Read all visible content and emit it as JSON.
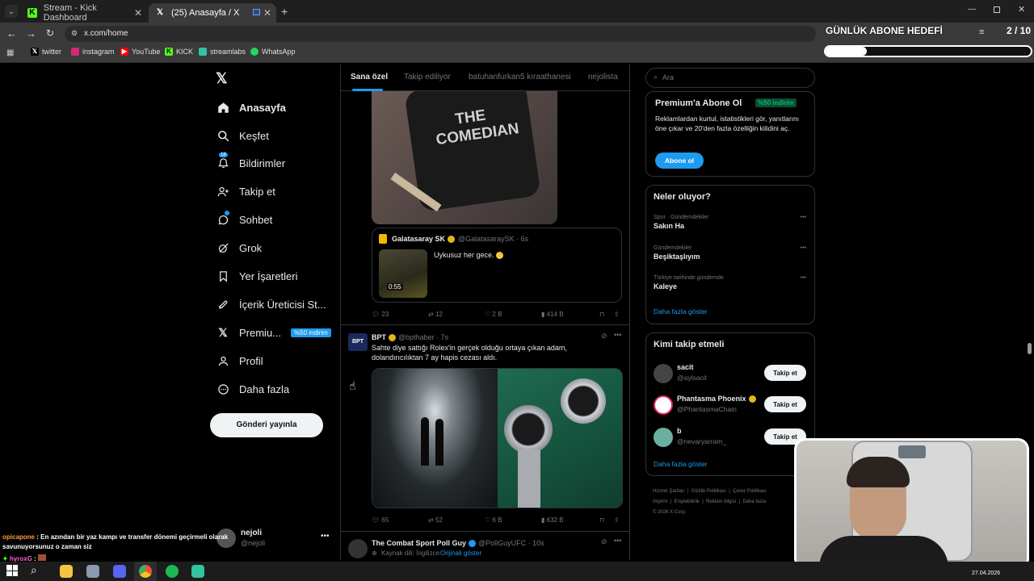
{
  "browser": {
    "tabs": [
      {
        "label": "Stream - Kick Dashboard",
        "icon": "kick-icon"
      },
      {
        "label": "(25) Anasayfa / X",
        "icon": "x-logo-icon"
      }
    ],
    "url": "x.com/home",
    "bookmarks": [
      "twitter",
      "instagram",
      "YouTube",
      "KICK",
      "streamlabs",
      "WhatsApp"
    ]
  },
  "overlay": {
    "goal_title": "GÜNLÜK ABONE HEDEFİ",
    "goal_count": "2 / 10",
    "goal_progress": 0.2,
    "chat": [
      {
        "user": "opicapone",
        "text": "En azından bir yaz kampı ve transfer dönemi geçirmeli olarak savunuyorsunuz o zaman siz"
      },
      {
        "user": "hyroxG",
        "text": ""
      }
    ]
  },
  "nav": {
    "items": [
      {
        "label": "Anasayfa",
        "icon": "home-icon"
      },
      {
        "label": "Keşfet",
        "icon": "search-icon"
      },
      {
        "label": "Bildirimler",
        "icon": "bell-icon",
        "badge": "18"
      },
      {
        "label": "Takip et",
        "icon": "follow-icon"
      },
      {
        "label": "Sohbet",
        "icon": "chat-icon"
      },
      {
        "label": "Grok",
        "icon": "grok-icon"
      },
      {
        "label": "Yer İşaretleri",
        "icon": "bookmark-icon"
      },
      {
        "label": "İçerik Üreticisi St...",
        "icon": "rocket-icon"
      },
      {
        "label": "Premiu...",
        "icon": "x-premium-icon",
        "badge": "%50 indirim"
      },
      {
        "label": "Profil",
        "icon": "profile-icon"
      },
      {
        "label": "Daha fazla",
        "icon": "more-icon"
      }
    ],
    "post_button": "Gönderi yayınla",
    "account_name": "nejoli",
    "account_handle": "@nejoli"
  },
  "feed": {
    "tabs": [
      "Sana özel",
      "Takip ediliyor",
      "batuhanfurkan5 kıraathanesi",
      "nejolista"
    ],
    "image_text": "THE COMEDIAN",
    "quoted": {
      "name": "Galatasaray SK",
      "handle": "@GalatasaraySK · 6s",
      "text": "Uykusuz her gece.",
      "duration": "0:55"
    },
    "post1_stats": {
      "replies": "23",
      "reposts": "12",
      "likes": "2 B",
      "views": "414 B"
    },
    "post2": {
      "name": "BPT",
      "handle": "@bpthaber · 7s",
      "text": "Sahte diye sattığı Rolex'in gerçek olduğu ortaya çıkan adam, dolandırıcılıktan 7 ay hapis cezası aldı."
    },
    "post2_stats": {
      "replies": "65",
      "reposts": "52",
      "likes": "6 B",
      "views": "632 B"
    },
    "post3": {
      "name": "The Combat Sport Poll Guy",
      "handle": "@PollGuyUFC · 10s",
      "source": "Kaynak dili: İngilizce",
      "original": "Orijinali göster"
    }
  },
  "right": {
    "search_placeholder": "Ara",
    "premium": {
      "title": "Premium'a Abone Ol",
      "badge": "%50 indirim",
      "text": "Reklamlardan kurtul, istatistikleri gör, yanıtlarını öne çıkar ve 20'den fazla özelliğin kilidini aç.",
      "button": "Abone ol"
    },
    "trends": {
      "title": "Neler oluyor?",
      "items": [
        {
          "category": "Spor · Gündemdekiler",
          "name": "Sakın Ha"
        },
        {
          "category": "Gündemdekiler",
          "name": "Beşiktaşlıyım"
        },
        {
          "category": "Türkiye tarihinde gündemde",
          "name": "Kaleye"
        }
      ],
      "more": "Daha fazla göster"
    },
    "who_to_follow": {
      "title": "Kimi takip etmeli",
      "users": [
        {
          "name": "sacit",
          "handle": "@aylsacit"
        },
        {
          "name": "Phantasma Phoenix",
          "handle": "@PhantasmaChain"
        },
        {
          "name": "b",
          "handle": "@nevaryarram_"
        }
      ],
      "button": "Takip et",
      "more": "Daha fazla göster"
    },
    "footer": [
      "Hizmet Şartları",
      "Gizlilik Politikası",
      "Çerez Politikası",
      "Imprint",
      "Erişilebilirlik",
      "Reklam bilgisi",
      "Daha fazla",
      "© 2026 X Corp."
    ]
  },
  "taskbar": {
    "date": "27.04.2026"
  },
  "colors": {
    "accent": "#1d9bf0",
    "premium_green": "#00ba7c"
  }
}
